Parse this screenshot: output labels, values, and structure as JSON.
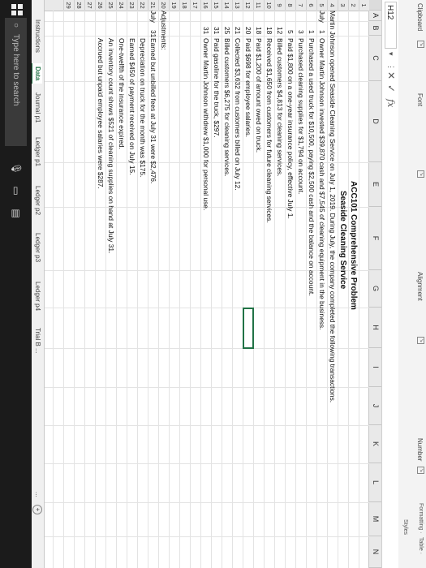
{
  "ribbon": {
    "clipboard": "Clipboard",
    "font": "Font",
    "alignment": "Alignment",
    "number": "Number",
    "styles": "Styles",
    "formatting": "Formatting ·",
    "table": "Table ·",
    "group_icon": "↘"
  },
  "formula_bar": {
    "name_box": "H12",
    "cancel": "✕",
    "enter": "✓",
    "fx": "fx",
    "content": ""
  },
  "columns": [
    "A",
    "B",
    "C",
    "D",
    "E",
    "F",
    "G",
    "H",
    "I",
    "J",
    "K",
    "L",
    "M",
    "N"
  ],
  "rows": [
    "1",
    "2",
    "3",
    "4",
    "5",
    "6",
    "7",
    "8",
    "9",
    "10",
    "11",
    "12",
    "13",
    "14",
    "15",
    "16",
    "17",
    "18",
    "19",
    "20",
    "21",
    "22",
    "23",
    "24",
    "25",
    "26",
    "27",
    "28",
    "29"
  ],
  "sheet": {
    "title": "ACC101 Comprehensive Problem",
    "subtitle": "Seaside Cleaning Service",
    "intro": "Martin Johnson opened Seaside Cleaning Service on July 1, 2019. During July, the company completed the following transactions.",
    "month": "July",
    "transactions": [
      {
        "day": "1",
        "text": "Owner Martin Johnson invested $39,870 cash and $7,545 of cleaning equipment in the business."
      },
      {
        "day": "1",
        "text": "Purchased a used truck for $10,500, paying $2,500 cash and the balance on account."
      },
      {
        "day": "3",
        "text": "Purchased cleaning supplies for $1,794 on account."
      },
      {
        "day": "5",
        "text": "Paid $1,800 on a one-year insurance policy, effective July 1."
      },
      {
        "day": "12",
        "text": "Billed customers $4,813 for cleaning services."
      },
      {
        "day": "18",
        "text": "Received $1,650 from customers for future cleaning services."
      },
      {
        "day": "18",
        "text": "Paid $1,200 of amount owed on truck."
      },
      {
        "day": "20",
        "text": "Paid $698 for employee salaries."
      },
      {
        "day": "21",
        "text": "Collected $3,632 from customers billed on July 12."
      },
      {
        "day": "25",
        "text": "Billed customers $6,275 for cleaning services."
      },
      {
        "day": "31",
        "text": "Paid gasoline for the truck, $297."
      },
      {
        "day": "31",
        "text": "Owner Martin Johnson withdrew $1,000 for personal use."
      }
    ],
    "adjustments_label": "Adjustments:",
    "adj_month": "July",
    "adj_day": "31",
    "adjustments": [
      "Earned but unbilled fees at July 31 were $2,476.",
      "Depreciation on truck for the month was $175.",
      "Earned $450 of payment received on July 15.",
      "One-twelfth of the insurance expired.",
      "An inventory count shows $521 of cleaning supplies on hand at July 31.",
      "Accrued but unpaid employee salaries were $287."
    ]
  },
  "sheet_tabs": [
    "Instructions",
    "Data",
    "Journal p1",
    "Ledger p1",
    "Ledger p2",
    "Ledger p3",
    "Ledger p4",
    "Trial B ..."
  ],
  "active_tab": "Data",
  "more_tabs": "...",
  "add_sheet": "+",
  "taskbar": {
    "search_placeholder": "Type here to search"
  },
  "colors": {
    "accent": "#217346",
    "taskbar": "#1b1b1b"
  }
}
